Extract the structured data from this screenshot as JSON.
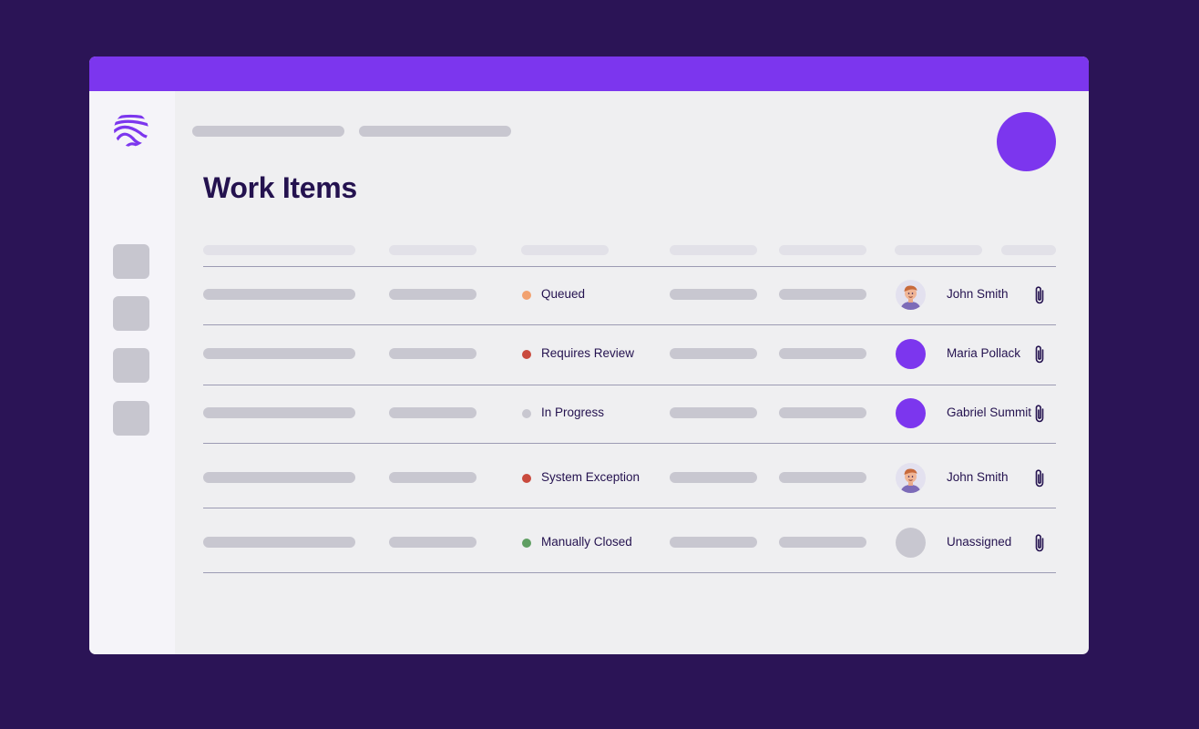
{
  "page": {
    "title": "Work Items"
  },
  "colors": {
    "brand": "#7c36ee",
    "background": "#2b1456",
    "text": "#24124f"
  },
  "sidebar": {
    "icons": [
      "logo-icon"
    ]
  },
  "rows": [
    {
      "status": "Queued",
      "status_color": "#f2a16f",
      "assignee": "John Smith",
      "avatar": "photo",
      "icon": "paperclip-icon"
    },
    {
      "status": "Requires Review",
      "status_color": "#c94a3d",
      "assignee": "Maria Pollack",
      "avatar": "purple",
      "icon": "paperclip-icon"
    },
    {
      "status": "In Progress",
      "status_color": "#c8c7d0",
      "assignee": "Gabriel Summit",
      "avatar": "purple",
      "icon": "paperclip-icon"
    },
    {
      "status": "System Exception",
      "status_color": "#c94a3d",
      "assignee": "John Smith",
      "avatar": "photo",
      "icon": "paperclip-icon"
    },
    {
      "status": "Manually Closed",
      "status_color": "#5f9e62",
      "assignee": "Unassigned",
      "avatar": "gray",
      "icon": "paperclip-icon"
    }
  ]
}
